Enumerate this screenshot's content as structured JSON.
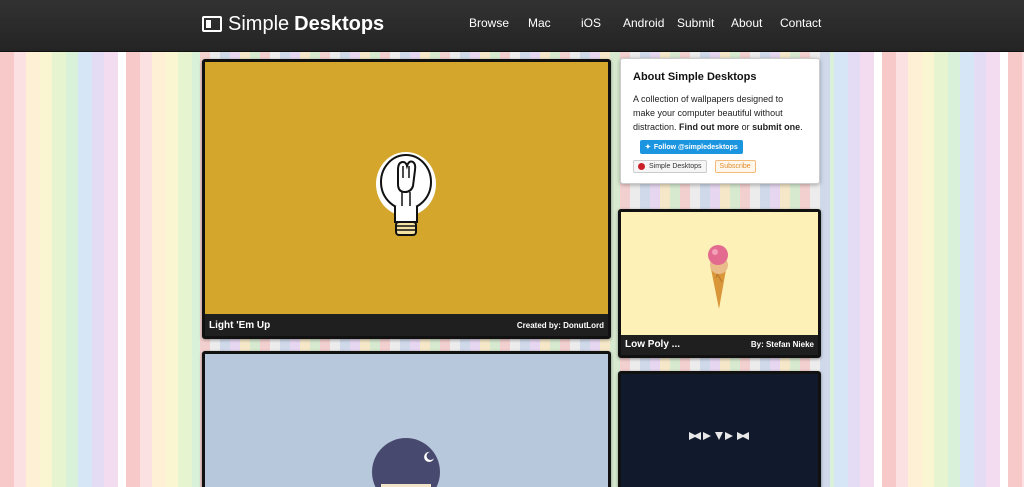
{
  "header": {
    "logo_light": "Simple",
    "logo_bold": "Desktops",
    "nav": [
      "Browse",
      "Mac",
      "iOS",
      "Android",
      "Submit",
      "About",
      "Contact"
    ]
  },
  "about": {
    "title": "About Simple Desktops",
    "text": "A collection of wallpapers designed to make your computer beautiful without distraction.",
    "find_out": "Find out more",
    "or": "or",
    "submit": "submit one",
    "period": ".",
    "twitter": "Follow @simpledesktops",
    "pinterest": "Simple Desktops",
    "subscribe": "Subscribe"
  },
  "cards": {
    "main1": {
      "title": "Light 'Em Up",
      "by": "Created by: DonutLord",
      "color": "#d4a72c"
    },
    "side1": {
      "title": "Low Poly ...",
      "by": "By: Stefan Nieke",
      "color": "#fdf1b8"
    },
    "main2": {
      "color": "#b8c8dc"
    },
    "side2": {
      "color": "#111a2c"
    }
  }
}
